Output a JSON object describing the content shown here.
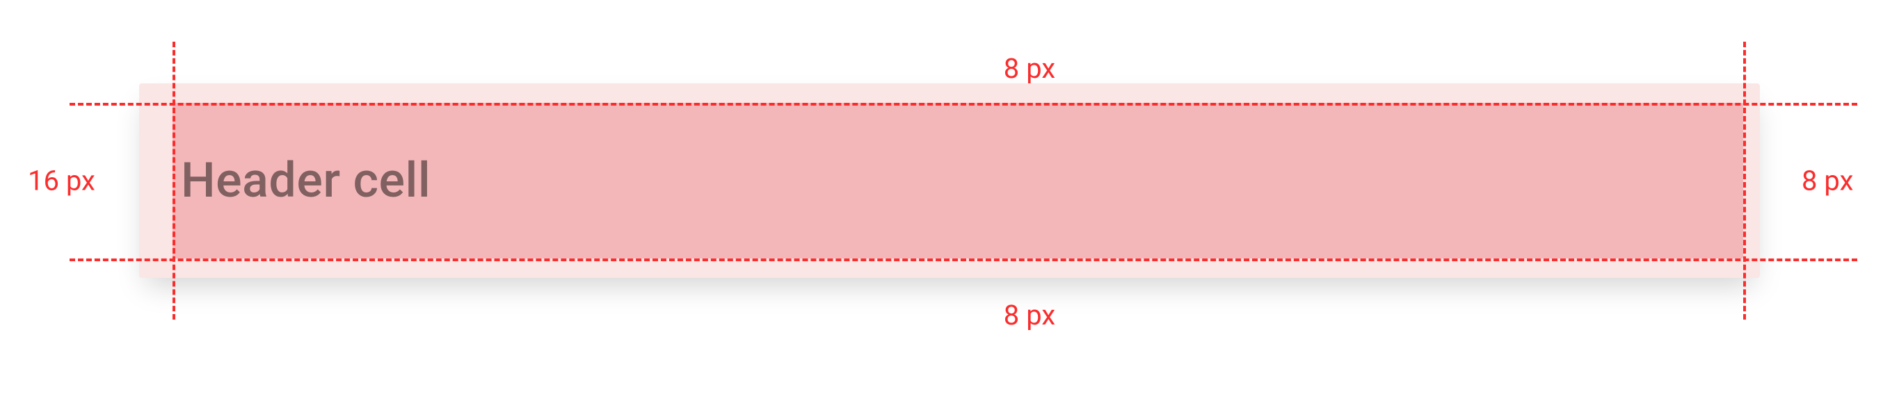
{
  "spec": {
    "title": "Header cell",
    "padding": {
      "top": "8 px",
      "bottom": "8 px",
      "left": "16 px",
      "right": "8 px"
    }
  }
}
